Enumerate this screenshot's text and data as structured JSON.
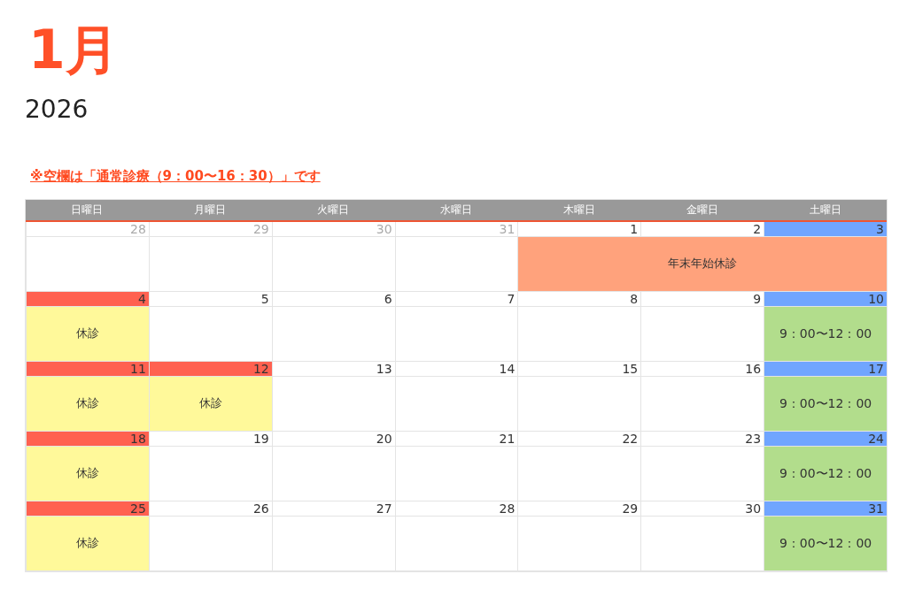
{
  "month": "1月",
  "year": "2026",
  "note": "※空欄は「通常診療（9：00〜16：30）」です",
  "weekdays": [
    "日曜日",
    "月曜日",
    "火曜日",
    "水曜日",
    "木曜日",
    "金曜日",
    "土曜日"
  ],
  "weeks": [
    {
      "days": [
        {
          "date": "28",
          "kind": "outside"
        },
        {
          "date": "29",
          "kind": "outside"
        },
        {
          "date": "30",
          "kind": "outside"
        },
        {
          "date": "31",
          "kind": "outside"
        },
        {
          "date": "1",
          "kind": "plain"
        },
        {
          "date": "2",
          "kind": "plain"
        },
        {
          "date": "3",
          "kind": "saturday"
        }
      ],
      "cells": [
        {
          "kind": "empty"
        },
        {
          "kind": "empty"
        },
        {
          "kind": "empty"
        },
        {
          "kind": "empty"
        },
        {
          "kind": "newyear",
          "label": "年末年始休診"
        },
        {
          "kind": "newyear"
        },
        {
          "kind": "newyear"
        }
      ]
    },
    {
      "days": [
        {
          "date": "4",
          "kind": "holiday"
        },
        {
          "date": "5",
          "kind": "plain"
        },
        {
          "date": "6",
          "kind": "plain"
        },
        {
          "date": "7",
          "kind": "plain"
        },
        {
          "date": "8",
          "kind": "plain"
        },
        {
          "date": "9",
          "kind": "plain"
        },
        {
          "date": "10",
          "kind": "saturday"
        }
      ],
      "cells": [
        {
          "kind": "closed",
          "label": "休診"
        },
        {
          "kind": "empty"
        },
        {
          "kind": "empty"
        },
        {
          "kind": "empty"
        },
        {
          "kind": "empty"
        },
        {
          "kind": "empty"
        },
        {
          "kind": "half",
          "label": "9：00〜12：00"
        }
      ]
    },
    {
      "days": [
        {
          "date": "11",
          "kind": "holiday"
        },
        {
          "date": "12",
          "kind": "holiday"
        },
        {
          "date": "13",
          "kind": "plain"
        },
        {
          "date": "14",
          "kind": "plain"
        },
        {
          "date": "15",
          "kind": "plain"
        },
        {
          "date": "16",
          "kind": "plain"
        },
        {
          "date": "17",
          "kind": "saturday"
        }
      ],
      "cells": [
        {
          "kind": "closed",
          "label": "休診"
        },
        {
          "kind": "closed",
          "label": "休診"
        },
        {
          "kind": "empty"
        },
        {
          "kind": "empty"
        },
        {
          "kind": "empty"
        },
        {
          "kind": "empty"
        },
        {
          "kind": "half",
          "label": "9：00〜12：00"
        }
      ]
    },
    {
      "days": [
        {
          "date": "18",
          "kind": "holiday"
        },
        {
          "date": "19",
          "kind": "plain"
        },
        {
          "date": "20",
          "kind": "plain"
        },
        {
          "date": "21",
          "kind": "plain"
        },
        {
          "date": "22",
          "kind": "plain"
        },
        {
          "date": "23",
          "kind": "plain"
        },
        {
          "date": "24",
          "kind": "saturday"
        }
      ],
      "cells": [
        {
          "kind": "closed",
          "label": "休診"
        },
        {
          "kind": "empty"
        },
        {
          "kind": "empty"
        },
        {
          "kind": "empty"
        },
        {
          "kind": "empty"
        },
        {
          "kind": "empty"
        },
        {
          "kind": "half",
          "label": "9：00〜12：00"
        }
      ]
    },
    {
      "days": [
        {
          "date": "25",
          "kind": "holiday"
        },
        {
          "date": "26",
          "kind": "plain"
        },
        {
          "date": "27",
          "kind": "plain"
        },
        {
          "date": "28",
          "kind": "plain"
        },
        {
          "date": "29",
          "kind": "plain"
        },
        {
          "date": "30",
          "kind": "plain"
        },
        {
          "date": "31",
          "kind": "saturday"
        }
      ],
      "cells": [
        {
          "kind": "closed",
          "label": "休診"
        },
        {
          "kind": "empty"
        },
        {
          "kind": "empty"
        },
        {
          "kind": "empty"
        },
        {
          "kind": "empty"
        },
        {
          "kind": "empty"
        },
        {
          "kind": "half",
          "label": "9：00〜12：00"
        }
      ]
    }
  ]
}
